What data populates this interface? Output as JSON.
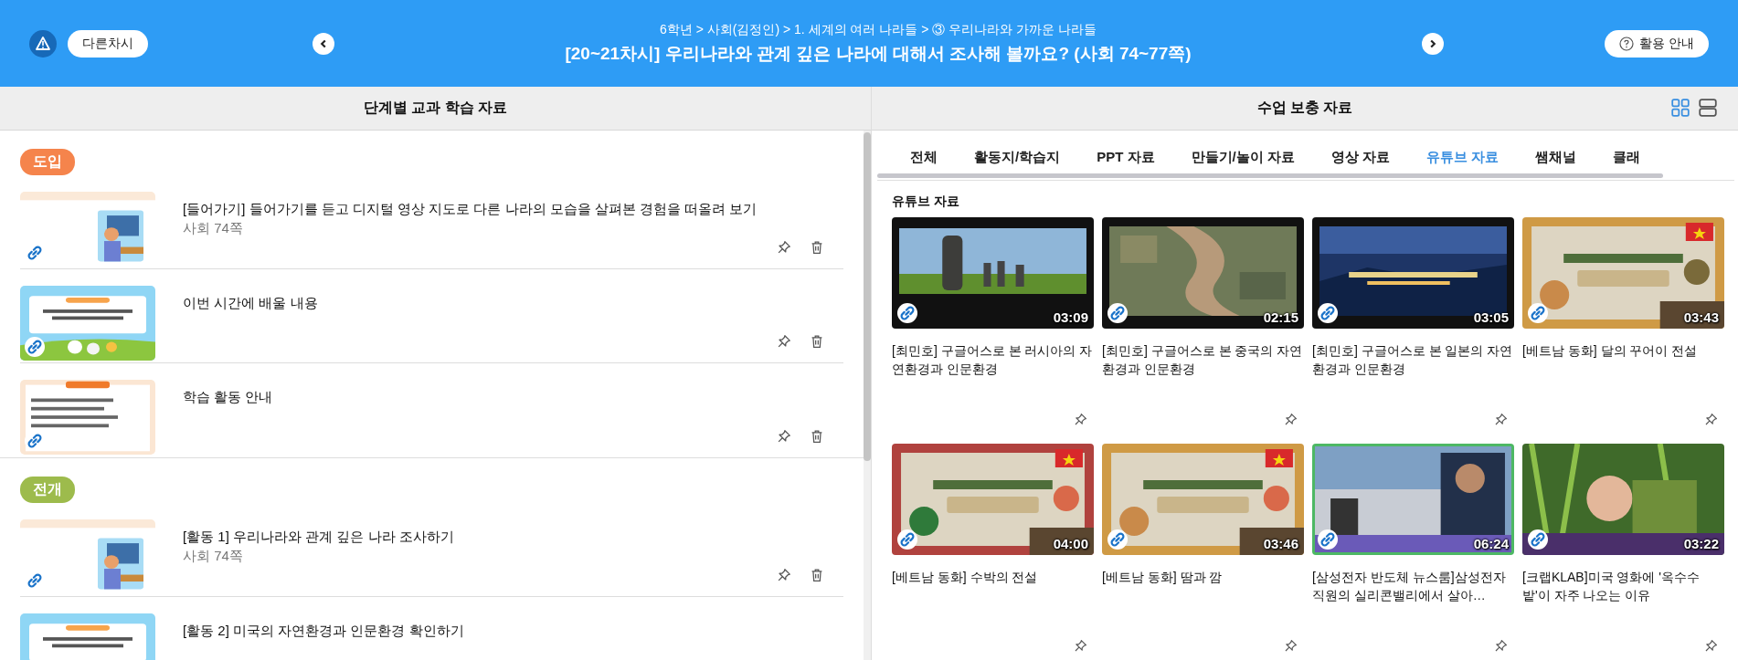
{
  "header": {
    "other_lesson_button": "다른차시",
    "breadcrumb": "6학년 > 사회(김정인) > 1. 세계의 여러 나라들 > ③ 우리나라와 가까운 나라들",
    "title": "[20~21차시] 우리나라와 관계 깊은 나라에 대해서 조사해 볼까요? (사회 74~77쪽)",
    "guide_button": "활용 안내"
  },
  "left_panel": {
    "title": "단계별 교과 학습 자료",
    "stages": [
      {
        "label": "도입",
        "color": "#f5844c",
        "items": [
          {
            "title": "[들어가기] 들어가기를 듣고 디지털 영상 지도로 다른 나라의 모습을 살펴본 경험을 떠올려 보기",
            "page": "사회 74쪽"
          },
          {
            "title": "이번 시간에 배울 내용"
          },
          {
            "title": "학습 활동 안내"
          }
        ]
      },
      {
        "label": "전개",
        "color": "#9dbb4c",
        "items": [
          {
            "title": "[활동 1] 우리나라와 관계 깊은 나라 조사하기",
            "page": "사회 74쪽"
          },
          {
            "title": "[활동 2] 미국의 자연환경과 인문환경 확인하기"
          }
        ]
      }
    ]
  },
  "right_panel": {
    "title": "수업 보충 자료",
    "view_modes": [
      {
        "kind": "grid",
        "selected": true
      },
      {
        "kind": "list",
        "selected": false
      }
    ],
    "tabs": [
      {
        "label": "전체",
        "selected": false
      },
      {
        "label": "활동지/학습지",
        "selected": false
      },
      {
        "label": "PPT 자료",
        "selected": false
      },
      {
        "label": "만들기/놀이 자료",
        "selected": false
      },
      {
        "label": "영상 자료",
        "selected": false
      },
      {
        "label": "유튜브 자료",
        "selected": true
      },
      {
        "label": "쌤채널",
        "selected": false
      },
      {
        "label": "클래",
        "selected": false
      }
    ],
    "section_title": "유튜브 자료",
    "videos": [
      {
        "title": "[최민호] 구글어스로 본 러시아의 자연환경과 인문환경",
        "duration": "03:09"
      },
      {
        "title": "[최민호] 구글어스로 본 중국의 자연환경과 인문환경",
        "duration": "02:15"
      },
      {
        "title": "[최민호] 구글어스로 본 일본의 자연환경과 인문환경",
        "duration": "03:05"
      },
      {
        "title": "[베트남 동화] 달의 꾸어이 전설",
        "duration": "03:43"
      },
      {
        "title": "[베트남 동화] 수박의 전설",
        "duration": "04:00"
      },
      {
        "title": "[베트남 동화] 땀과 깜",
        "duration": "03:46"
      },
      {
        "title": "[삼성전자 반도체 뉴스룸]삼성전자 직원의 실리콘밸리에서 살아…",
        "duration": "06:24"
      },
      {
        "title": "[크랩KLAB]미국 영화에 '옥수수밭'이 자주 나오는 이유",
        "duration": "03:22"
      }
    ]
  }
}
